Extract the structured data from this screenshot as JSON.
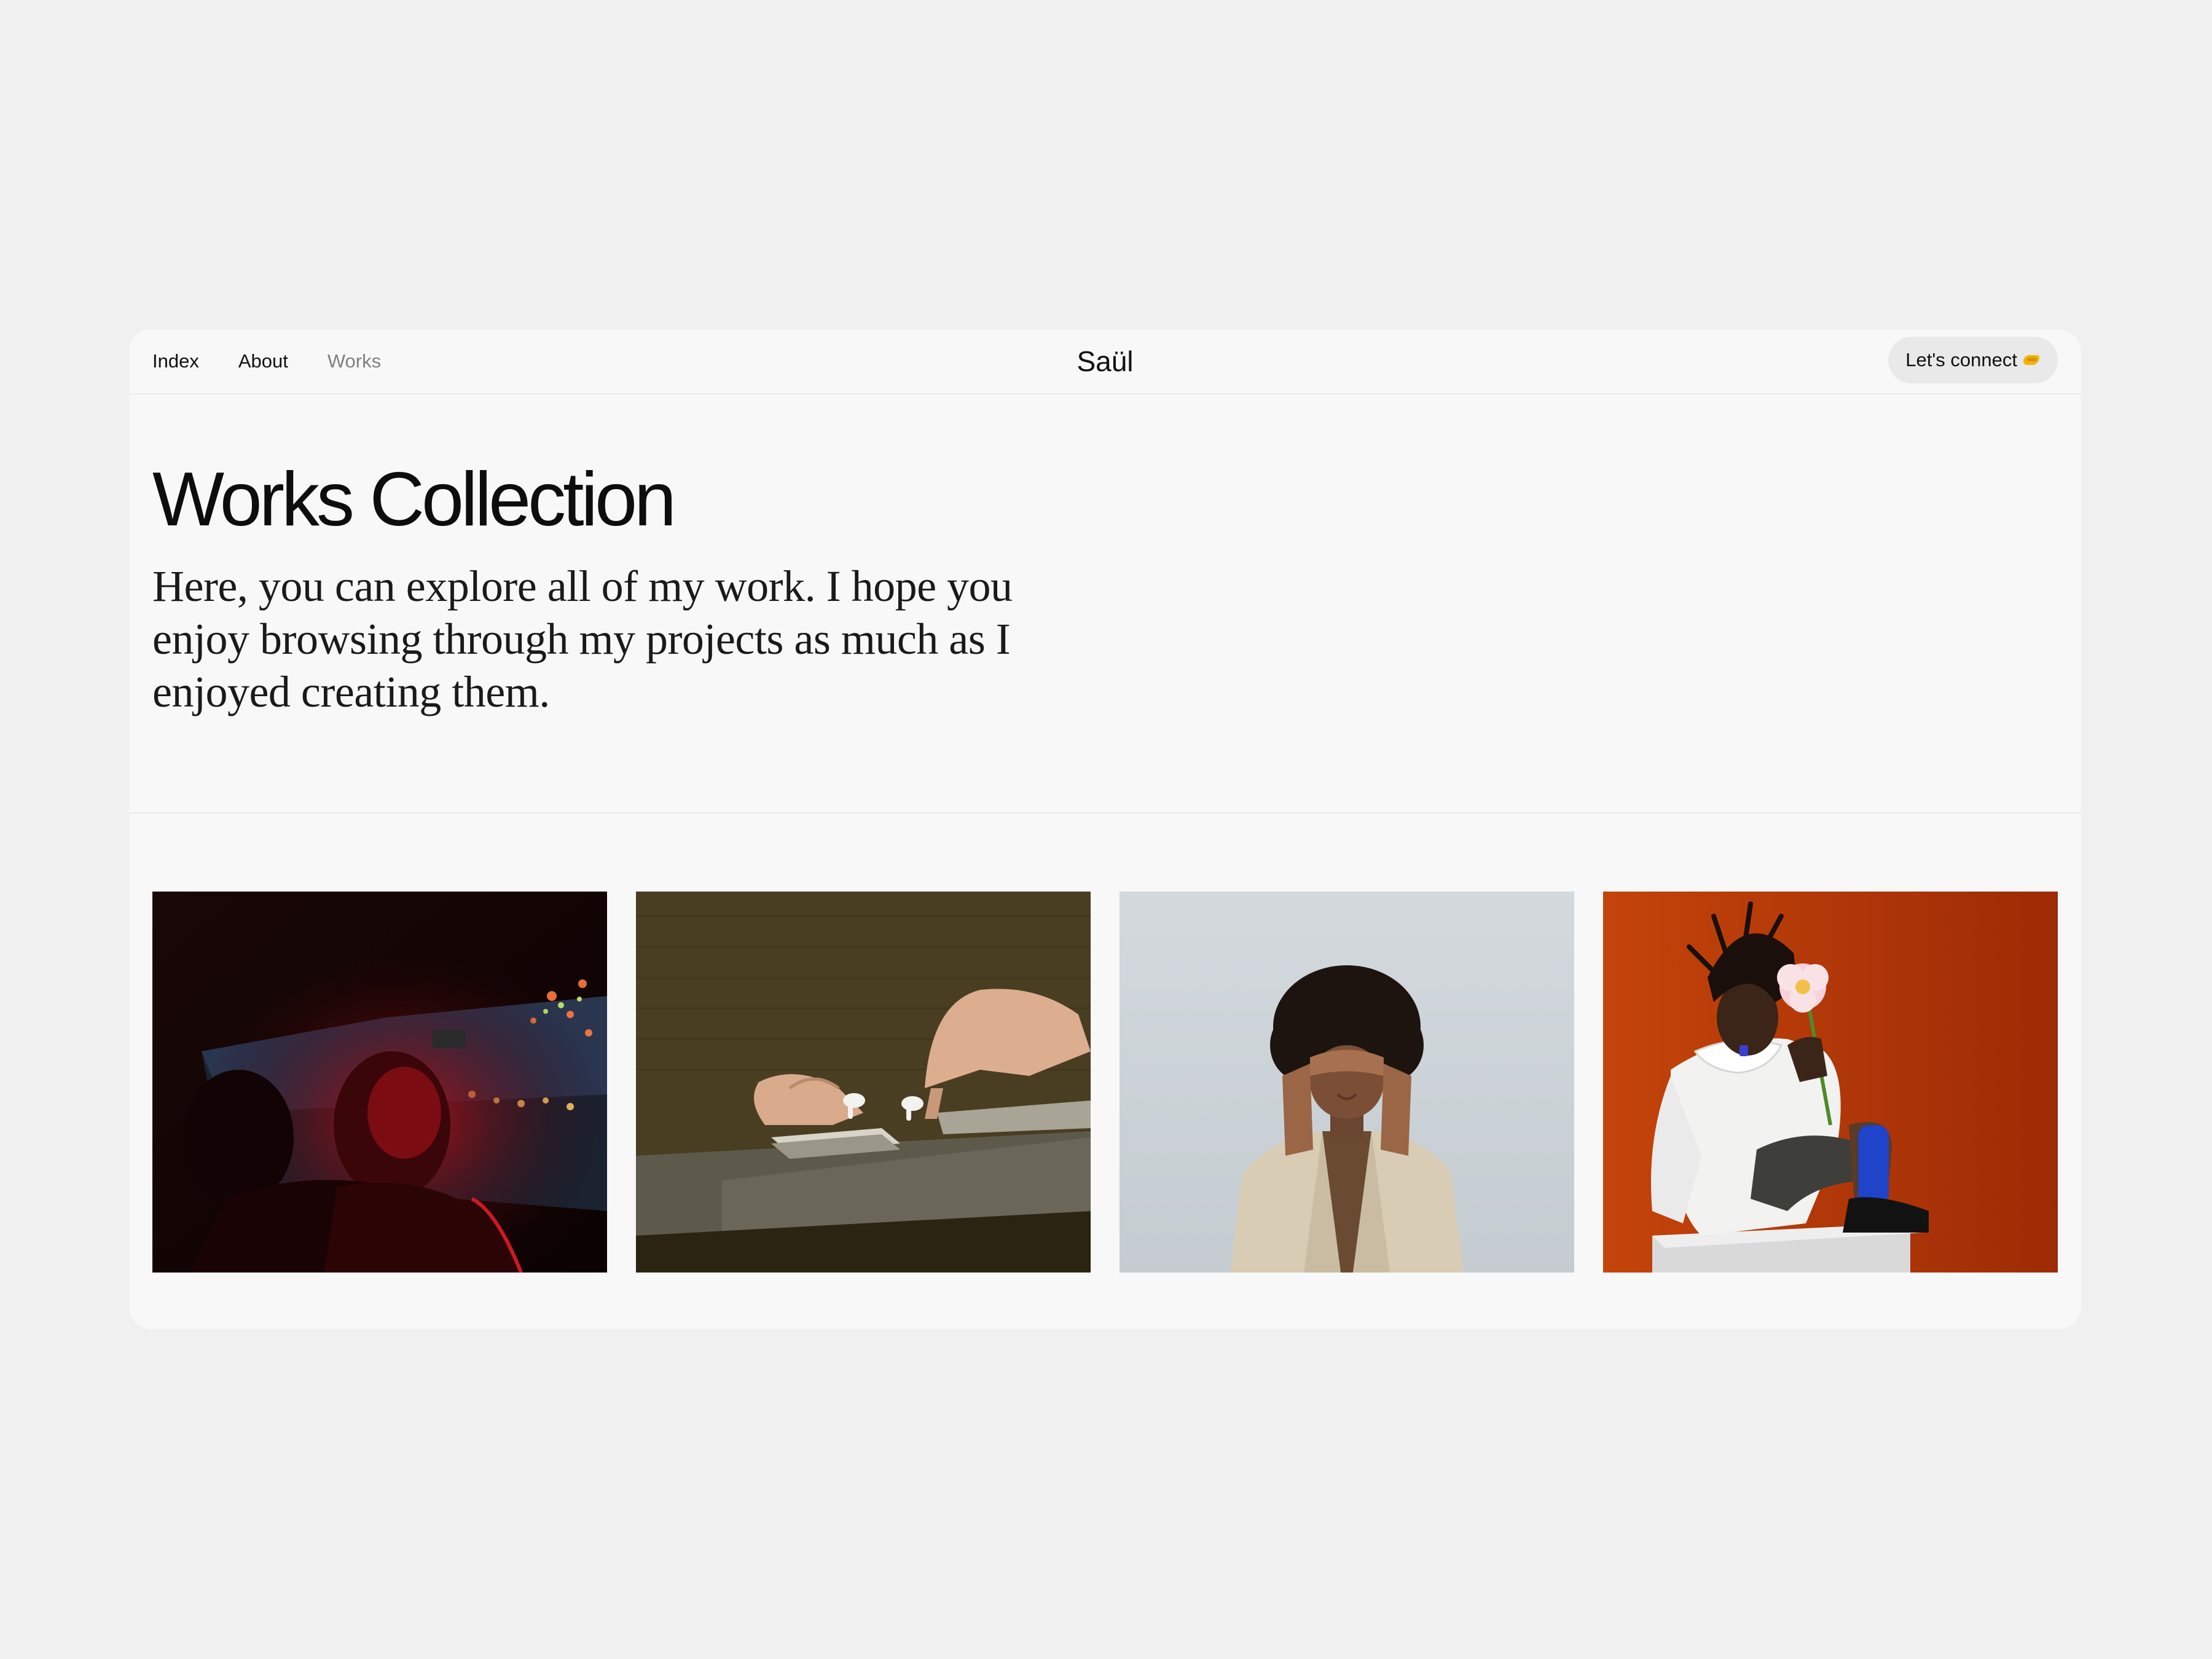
{
  "nav": {
    "links": [
      {
        "label": "Index"
      },
      {
        "label": "About"
      },
      {
        "label": "Works"
      }
    ],
    "brand": "Saül",
    "cta": {
      "label": "Let's connect",
      "icon": "handshake-icon"
    }
  },
  "hero": {
    "title": "Works Collection",
    "subtitle": "Here, you can explore all of my work. I hope you enjoy browsing through my projects as much as I enjoyed creating them."
  },
  "gallery": {
    "images": [
      {
        "name": "work-image-car-night"
      },
      {
        "name": "work-image-earbuds-hands"
      },
      {
        "name": "work-image-covered-eyes"
      },
      {
        "name": "work-image-flower-portrait"
      }
    ]
  },
  "colors": {
    "page_background": "#f0f0f0",
    "card_background": "#f8f8f8",
    "button_background": "#e9e9e9",
    "muted_text": "#808080"
  }
}
